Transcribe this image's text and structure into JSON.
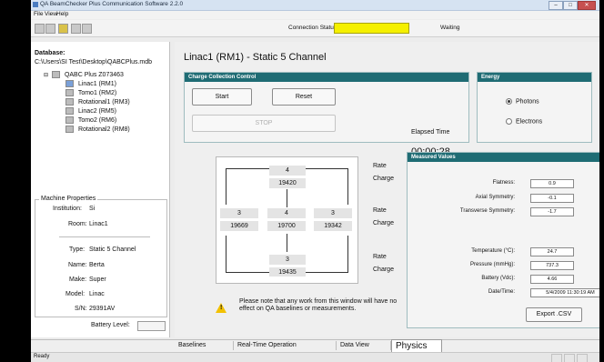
{
  "window": {
    "title": "QA BeamChecker Plus Communication Software 2.2.0"
  },
  "menu": {
    "file": "File",
    "view": "View",
    "help": "Help"
  },
  "connection": {
    "label": "Connection Status:",
    "status": "Waiting",
    "status_color": "#f5f000"
  },
  "sidebar": {
    "db_label": "Database:",
    "db_path": "C:\\Users\\SI Test\\Desktop\\QABCPlus.mdb",
    "tree": {
      "root": "QABC Plus Z073463",
      "items": [
        "Linac1 (RM1)",
        "Tomo1 (RM2)",
        "Rotational1 (RM3)",
        "Linac2 (RM5)",
        "Tomo2 (RM6)",
        "Rotational2 (RM8)"
      ]
    },
    "machine": {
      "legend": "Machine Properties",
      "institution_label": "Institution:",
      "institution": "Si",
      "room_label": "Room:",
      "room": "Linac1",
      "type_label": "Type:",
      "type": "Static 5 Channel",
      "name_label": "Name:",
      "name": "Berta",
      "make_label": "Make:",
      "make": "Super",
      "model_label": "Model:",
      "model": "Linac",
      "sn_label": "S/N:",
      "sn": "29391AV"
    },
    "battery_label": "Battery Level:"
  },
  "main": {
    "title": "Linac1 (RM1) - Static 5 Channel",
    "charge": {
      "caption": "Charge Collection Control",
      "start": "Start",
      "reset": "Reset",
      "stop": "STOP"
    },
    "elapsed": {
      "label": "Elapsed Time",
      "value": "00:00:28"
    },
    "energy": {
      "caption": "Energy",
      "photons": "Photons",
      "electrons": "Electrons",
      "selected": "Photons"
    },
    "grid": {
      "top": {
        "rate": "4",
        "charge": "19420"
      },
      "left": {
        "rate": "3",
        "charge": "19669"
      },
      "center": {
        "rate": "4",
        "charge": "19700"
      },
      "right": {
        "rate": "3",
        "charge": "19342"
      },
      "bottom": {
        "rate": "3",
        "charge": "19435"
      }
    },
    "row_labels": {
      "rate": "Rate",
      "charge": "Charge"
    },
    "measured": {
      "caption": "Measured Values",
      "flatness_label": "Flatness:",
      "flatness": "0.9",
      "axial_label": "Axial Symmetry:",
      "axial": "-0.1",
      "transverse_label": "Transverse Symmetry:",
      "transverse": "-1.7",
      "temp_label": "Temperature (°C):",
      "temp": "24.7",
      "pressure_label": "Pressure (mmHg):",
      "pressure": "737.3",
      "battery_label": "Battery (Vdc):",
      "battery": "4.66",
      "datetime_label": "Date/Time:",
      "datetime": "5/4/2009 11:30:19 AM",
      "export": "Export .CSV"
    },
    "note": "Please note that any work from this window will have no effect on QA baselines or measurements."
  },
  "tabs": [
    "Baselines",
    "Real-Time Operation",
    "Data View",
    "Physics"
  ],
  "active_tab": "Physics",
  "status": {
    "text": "Ready"
  }
}
